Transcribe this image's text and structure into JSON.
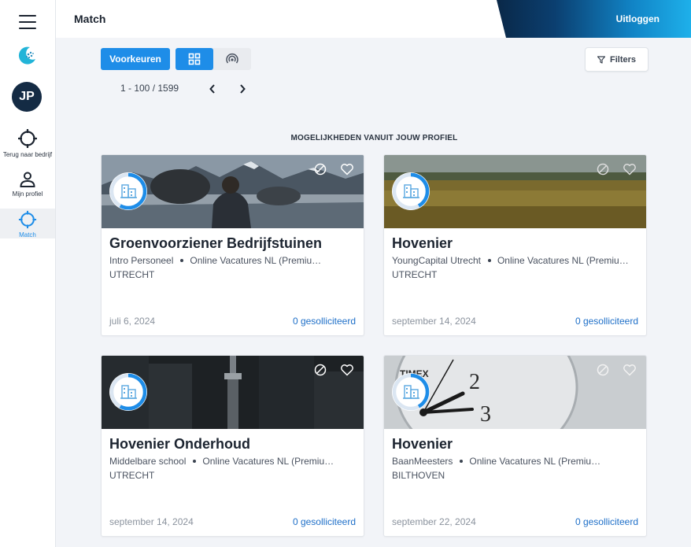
{
  "header": {
    "title": "Match",
    "logout_label": "Uitloggen"
  },
  "sidebar": {
    "avatar_initials": "JP",
    "items": [
      {
        "label": "Terug naar bedrijf",
        "icon": "crosshair-icon"
      },
      {
        "label": "Mijn profiel",
        "icon": "person-icon"
      },
      {
        "label": "Match",
        "icon": "crosshair-icon",
        "active": true
      }
    ]
  },
  "toolbar": {
    "preferences_label": "Voorkeuren",
    "filters_label": "Filters",
    "view_modes": [
      "grid-view-icon",
      "radar-view-icon"
    ],
    "active_view": "grid-view-icon",
    "pagination": "1 - 100 / 1599"
  },
  "section_title": "MOGELIJKHEDEN VANUIT JOUW PROFIEL",
  "colors": {
    "accent": "#1e8de8",
    "link": "#1e6fc8",
    "sidebar_dark": "#142b44"
  },
  "cards": [
    {
      "title": "Groenvoorziener Bedrijfstuinen",
      "company": "Intro Personeel",
      "source": "Online Vacatures NL (Premiu…",
      "city": "UTRECHT",
      "date": "juli 6, 2024",
      "applied": "0 gesolliciteerd",
      "match": 0.58,
      "image": "mountain-lake-photo"
    },
    {
      "title": "Hovenier",
      "company": "YoungCapital Utrecht",
      "source": "Online Vacatures NL (Premiu…",
      "city": "UTRECHT",
      "date": "september 14, 2024",
      "applied": "0 gesolliciteerd",
      "match": 0.42,
      "image": "wheat-field-photo"
    },
    {
      "title": "Hovenier Onderhoud",
      "company": "Middelbare school",
      "source": "Online Vacatures NL (Premiu…",
      "city": "UTRECHT",
      "date": "september 14, 2024",
      "applied": "0 gesolliciteerd",
      "match": 0.58,
      "image": "city-tower-photo"
    },
    {
      "title": "Hovenier",
      "company": "BaanMeesters",
      "source": "Online Vacatures NL (Premiu…",
      "city": "BILTHOVEN",
      "date": "september 22, 2024",
      "applied": "0 gesolliciteerd",
      "match": 0.42,
      "image": "clock-photo",
      "image_text": [
        "TIMEX",
        "2",
        "3"
      ]
    }
  ]
}
